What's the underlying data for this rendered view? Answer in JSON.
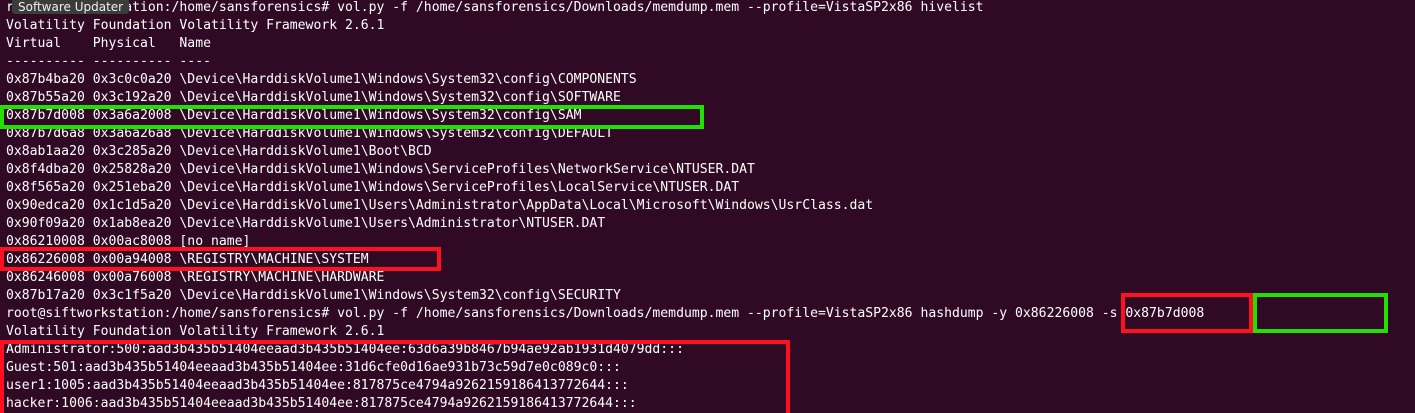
{
  "terminal": {
    "lines": [
      "root@siftworkstation:/home/sansforensics# vol.py -f /home/sansforensics/Downloads/memdump.mem --profile=VistaSP2x86 hivelist",
      "Volatility Foundation Volatility Framework 2.6.1",
      "Virtual    Physical   Name",
      "---------- ---------- ----",
      "0x87b4ba20 0x3c0c0a20 \\Device\\HarddiskVolume1\\Windows\\System32\\config\\COMPONENTS",
      "0x87b55a20 0x3c192a20 \\Device\\HarddiskVolume1\\Windows\\System32\\config\\SOFTWARE",
      "0x87b7d008 0x3a6a2008 \\Device\\HarddiskVolume1\\Windows\\System32\\config\\SAM",
      "0x87b7d6a8 0x3a6a26a8 \\Device\\HarddiskVolume1\\Windows\\System32\\config\\DEFAULT",
      "0x8ab1aa20 0x3c285a20 \\Device\\HarddiskVolume1\\Boot\\BCD",
      "0x8f4dba20 0x25828a20 \\Device\\HarddiskVolume1\\Windows\\ServiceProfiles\\NetworkService\\NTUSER.DAT",
      "0x8f565a20 0x251eba20 \\Device\\HarddiskVolume1\\Windows\\ServiceProfiles\\LocalService\\NTUSER.DAT",
      "0x90edca20 0x1c1d5a20 \\Device\\HarddiskVolume1\\Users\\Administrator\\AppData\\Local\\Microsoft\\Windows\\UsrClass.dat",
      "0x90f09a20 0x1ab8ea20 \\Device\\HarddiskVolume1\\Users\\Administrator\\NTUSER.DAT",
      "0x86210008 0x00ac8008 [no name]",
      "0x86226008 0x00a94008 \\REGISTRY\\MACHINE\\SYSTEM",
      "0x86246008 0x00a76008 \\REGISTRY\\MACHINE\\HARDWARE",
      "0x87b17a20 0x3c1f5a20 \\Device\\HarddiskVolume1\\Windows\\System32\\config\\SECURITY",
      "root@siftworkstation:/home/sansforensics# vol.py -f /home/sansforensics/Downloads/memdump.mem --profile=VistaSP2x86 hashdump -y 0x86226008 -s 0x87b7d008",
      "Volatility Foundation Volatility Framework 2.6.1",
      "Administrator:500:aad3b435b51404eeaad3b435b51404ee:63d6a39b8467b94ae92ab1931d4079dd:::",
      "Guest:501:aad3b435b51404eeaad3b435b51404ee:31d6cfe0d16ae931b73c59d7e0c089c0:::",
      "user1:1005:aad3b435b51404eeaad3b435b51404ee:817875ce4794a9262159186413772644:::",
      "hacker:1006:aad3b435b51404eeaad3b435b51404ee:817875ce4794a9262159186413772644:::"
    ]
  },
  "tooltip": {
    "text": "Software Updater"
  },
  "colors": {
    "background": "#300a24",
    "text": "#ffffff",
    "highlight_green": "#22e000",
    "highlight_red": "#ff1020"
  }
}
